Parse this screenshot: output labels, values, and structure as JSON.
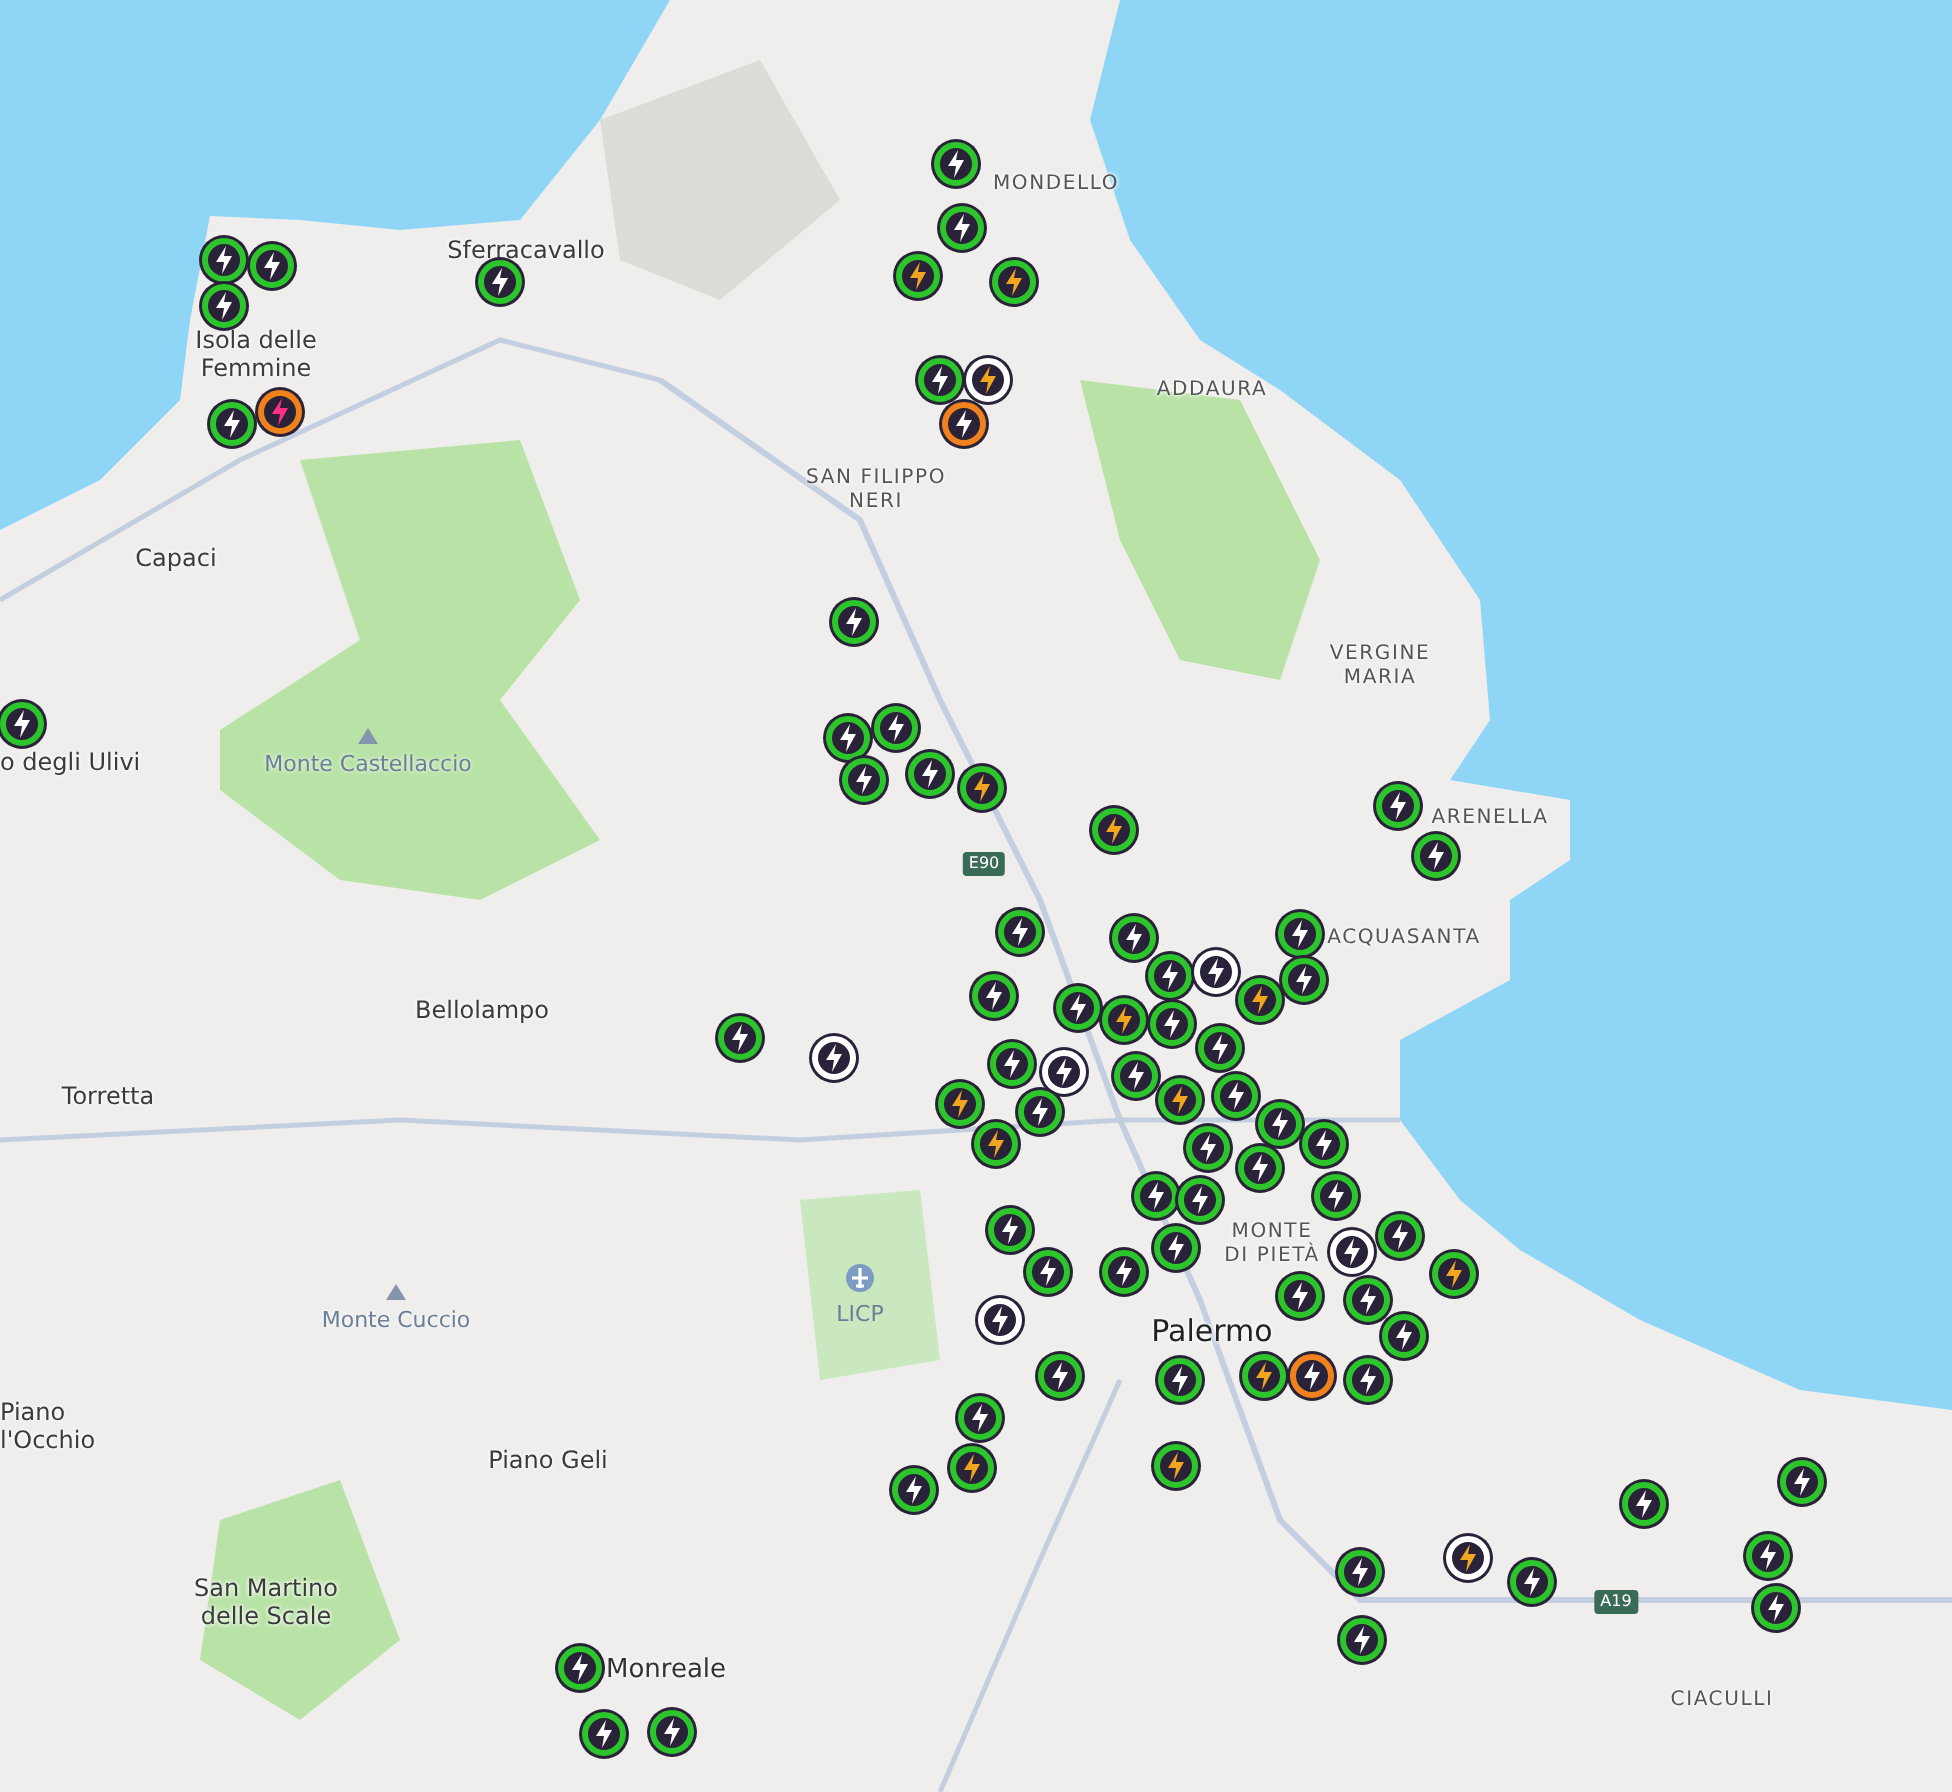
{
  "labels": [
    {
      "text": "Isola delle\nFemmine",
      "kind": "place"
    },
    {
      "text": "Sferracavallo",
      "kind": "place"
    },
    {
      "text": "Capaci",
      "kind": "place"
    },
    {
      "text": "o degli Ulivi",
      "kind": "place"
    },
    {
      "text": "Monte Castellaccio",
      "kind": "peak"
    },
    {
      "text": "MONDELLO",
      "kind": "district"
    },
    {
      "text": "ADDAURA",
      "kind": "district"
    },
    {
      "text": "SAN FILIPPO\nNERI",
      "kind": "district"
    },
    {
      "text": "VERGINE\nMARIA",
      "kind": "district"
    },
    {
      "text": "ARENELLA",
      "kind": "district"
    },
    {
      "text": "ACQUASANTA",
      "kind": "district"
    },
    {
      "text": "Bellolampo",
      "kind": "place"
    },
    {
      "text": "Torretta",
      "kind": "place"
    },
    {
      "text": "E90",
      "kind": "road"
    },
    {
      "text": "Monte Cuccio",
      "kind": "peak"
    },
    {
      "text": "LICP",
      "kind": "airport"
    },
    {
      "text": "Piano\nl'Occhio",
      "kind": "place"
    },
    {
      "text": "Piano Geli",
      "kind": "place"
    },
    {
      "text": "San Martino\ndelle Scale",
      "kind": "place"
    },
    {
      "text": "Monreale",
      "kind": "town"
    },
    {
      "text": "Palermo",
      "kind": "city"
    },
    {
      "text": "MONTE\nDI PIETÀ",
      "kind": "district"
    },
    {
      "text": "CIACULLI",
      "kind": "district"
    },
    {
      "text": "A19",
      "kind": "road"
    }
  ],
  "pins": [
    {
      "color": "#2cc52c",
      "kind": "white"
    },
    {
      "color": "#2cc52c",
      "kind": "white"
    },
    {
      "color": "#2cc52c",
      "kind": "white"
    },
    {
      "color": "#2cc52c",
      "kind": "white"
    },
    {
      "color": "#f0821e",
      "kind": "pink"
    },
    {
      "color": "#2cc52c",
      "kind": "white"
    },
    {
      "color": "#2cc52c",
      "kind": "white"
    },
    {
      "color": "#2cc52c",
      "kind": "white"
    },
    {
      "color": "#2cc52c",
      "kind": "white"
    },
    {
      "color": "#2cc52c",
      "kind": "amber"
    },
    {
      "color": "#2cc52c",
      "kind": "amber"
    },
    {
      "color": "#2cc52c",
      "kind": "white"
    },
    {
      "color": "#ffffff",
      "kind": "amber"
    },
    {
      "color": "#f0821e",
      "kind": "white"
    },
    {
      "color": "#2cc52c",
      "kind": "white"
    },
    {
      "color": "#2cc52c",
      "kind": "white"
    },
    {
      "color": "#2cc52c",
      "kind": "white"
    },
    {
      "color": "#2cc52c",
      "kind": "white"
    },
    {
      "color": "#2cc52c",
      "kind": "white"
    },
    {
      "color": "#2cc52c",
      "kind": "amber"
    },
    {
      "color": "#2cc52c",
      "kind": "amber"
    },
    {
      "color": "#2cc52c",
      "kind": "white"
    },
    {
      "color": "#2cc52c",
      "kind": "white"
    },
    {
      "color": "#2cc52c",
      "kind": "white"
    },
    {
      "color": "#2cc52c",
      "kind": "white"
    },
    {
      "color": "#2cc52c",
      "kind": "white"
    },
    {
      "color": "#2cc52c",
      "kind": "white"
    },
    {
      "color": "#2cc52c",
      "kind": "white"
    },
    {
      "color": "#2cc52c",
      "kind": "white"
    },
    {
      "color": "#ffffff",
      "kind": "white"
    },
    {
      "color": "#2cc52c",
      "kind": "amber"
    },
    {
      "color": "#2cc52c",
      "kind": "white"
    },
    {
      "color": "#2cc52c",
      "kind": "amber"
    },
    {
      "color": "#2cc52c",
      "kind": "white"
    },
    {
      "color": "#2cc52c",
      "kind": "white"
    },
    {
      "color": "#2cc52c",
      "kind": "white"
    },
    {
      "color": "#ffffff",
      "kind": "white"
    },
    {
      "color": "#2cc52c",
      "kind": "amber"
    },
    {
      "color": "#2cc52c",
      "kind": "white"
    },
    {
      "color": "#ffffff",
      "kind": "white"
    },
    {
      "color": "#2cc52c",
      "kind": "white"
    },
    {
      "color": "#2cc52c",
      "kind": "amber"
    },
    {
      "color": "#2cc52c",
      "kind": "white"
    },
    {
      "color": "#2cc52c",
      "kind": "amber"
    },
    {
      "color": "#2cc52c",
      "kind": "white"
    },
    {
      "color": "#2cc52c",
      "kind": "white"
    },
    {
      "color": "#2cc52c",
      "kind": "white"
    },
    {
      "color": "#2cc52c",
      "kind": "white"
    },
    {
      "color": "#2cc52c",
      "kind": "white"
    },
    {
      "color": "#2cc52c",
      "kind": "white"
    },
    {
      "color": "#2cc52c",
      "kind": "white"
    },
    {
      "color": "#2cc52c",
      "kind": "white"
    },
    {
      "color": "#2cc52c",
      "kind": "white"
    },
    {
      "color": "#2cc52c",
      "kind": "white"
    },
    {
      "color": "#2cc52c",
      "kind": "white"
    },
    {
      "color": "#2cc52c",
      "kind": "white"
    },
    {
      "color": "#ffffff",
      "kind": "white"
    },
    {
      "color": "#2cc52c",
      "kind": "white"
    },
    {
      "color": "#2cc52c",
      "kind": "white"
    },
    {
      "color": "#2cc52c",
      "kind": "amber"
    },
    {
      "color": "#2cc52c",
      "kind": "white"
    },
    {
      "color": "#ffffff",
      "kind": "white"
    },
    {
      "color": "#2cc52c",
      "kind": "white"
    },
    {
      "color": "#2cc52c",
      "kind": "white"
    },
    {
      "color": "#2cc52c",
      "kind": "amber"
    },
    {
      "color": "#f0821e",
      "kind": "white"
    },
    {
      "color": "#2cc52c",
      "kind": "white"
    },
    {
      "color": "#2cc52c",
      "kind": "white"
    },
    {
      "color": "#2cc52c",
      "kind": "white"
    },
    {
      "color": "#2cc52c",
      "kind": "amber"
    },
    {
      "color": "#2cc52c",
      "kind": "amber"
    },
    {
      "color": "#2cc52c",
      "kind": "white"
    },
    {
      "color": "#2cc52c",
      "kind": "white"
    },
    {
      "color": "#ffffff",
      "kind": "amber"
    },
    {
      "color": "#2cc52c",
      "kind": "white"
    },
    {
      "color": "#2cc52c",
      "kind": "white"
    },
    {
      "color": "#2cc52c",
      "kind": "white"
    },
    {
      "color": "#2cc52c",
      "kind": "white"
    },
    {
      "color": "#2cc52c",
      "kind": "white"
    },
    {
      "color": "#2cc52c",
      "kind": "white"
    },
    {
      "color": "#2cc52c",
      "kind": "white"
    },
    {
      "color": "#2cc52c",
      "kind": "white"
    },
    {
      "color": "#2cc52c",
      "kind": "white"
    }
  ]
}
